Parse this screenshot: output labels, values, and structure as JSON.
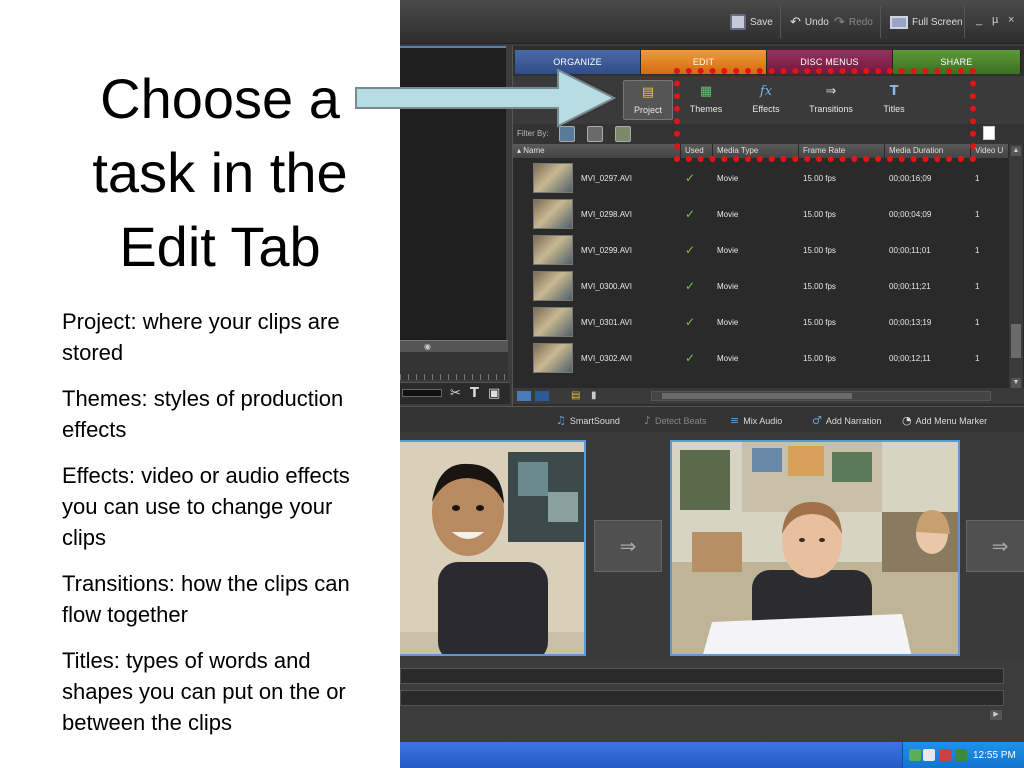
{
  "slide": {
    "title_lines": [
      "Choose a",
      "task in the",
      "Edit Tab"
    ],
    "bullets": [
      "Project: where your clips are stored",
      "Themes: styles of production effects",
      "Effects: video or audio effects you can use to change your clips",
      "Transitions: how the clips can flow together",
      "Titles: types of words and shapes you can put on the or between the clips"
    ]
  },
  "toolbar": {
    "save": "Save",
    "undo": "Undo",
    "redo": "Redo",
    "full_screen": "Full Screen",
    "minimize": "_",
    "restore": "µ",
    "close": "×"
  },
  "tabs": {
    "organize": "ORGANIZE",
    "edit": "EDIT",
    "disc_menus": "DISC MENUS",
    "share": "SHARE"
  },
  "tasks": {
    "project": "Project",
    "themes": "Themes",
    "effects": "Effects",
    "transitions": "Transitions",
    "titles": "Titles"
  },
  "filter": {
    "label": "Filter By:"
  },
  "media_table": {
    "columns": [
      "▴ Name",
      "Used",
      "Media Type",
      "Frame Rate",
      "Media Duration",
      "Video U"
    ],
    "rows": [
      {
        "name": "MVI_0297.AVI",
        "used": "✓",
        "type": "Movie",
        "rate": "15.00 fps",
        "duration": "00;00;16;09",
        "video": "1"
      },
      {
        "name": "MVI_0298.AVI",
        "used": "✓",
        "type": "Movie",
        "rate": "15.00 fps",
        "duration": "00;00;04;09",
        "video": "1"
      },
      {
        "name": "MVI_0299.AVI",
        "used": "✓",
        "type": "Movie",
        "rate": "15.00 fps",
        "duration": "00;00;11;01",
        "video": "1"
      },
      {
        "name": "MVI_0300.AVI",
        "used": "✓",
        "type": "Movie",
        "rate": "15.00 fps",
        "duration": "00;00;11;21",
        "video": "1"
      },
      {
        "name": "MVI_0301.AVI",
        "used": "✓",
        "type": "Movie",
        "rate": "15.00 fps",
        "duration": "00;00;13;19",
        "video": "1"
      },
      {
        "name": "MVI_0302.AVI",
        "used": "✓",
        "type": "Movie",
        "rate": "15.00 fps",
        "duration": "00;00;12;11",
        "video": "1"
      }
    ]
  },
  "storyboard_toolbar": {
    "smartsound": "SmartSound",
    "detect_beats": "Detect Beats",
    "mix_audio": "Mix Audio",
    "add_narration": "Add Narration",
    "add_menu_marker": "Add Menu Marker"
  },
  "system_tray": {
    "clock": "12:55 PM"
  },
  "colors": {
    "highlight": "#e41414",
    "arrow_fill": "#b7dde4",
    "edit_tab": "#e8821e"
  }
}
